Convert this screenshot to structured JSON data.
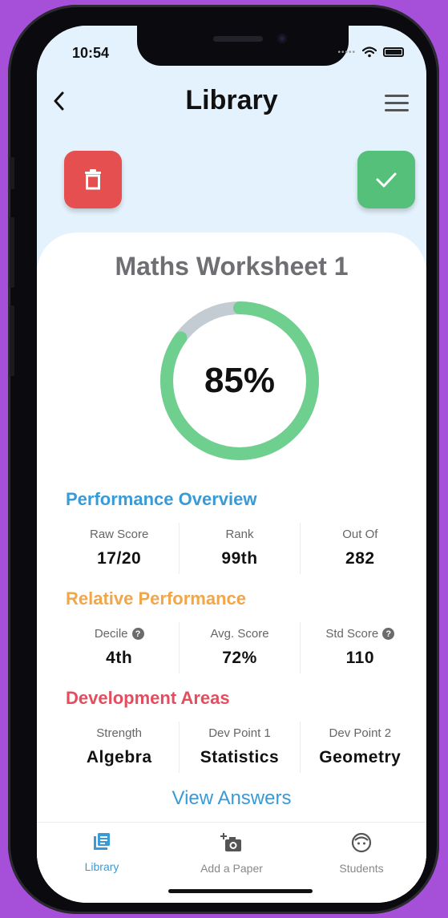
{
  "status_bar": {
    "time": "10:54"
  },
  "header": {
    "title": "Library"
  },
  "worksheet": {
    "title": "Maths Worksheet 1",
    "score_percent": 85,
    "score_label": "85%"
  },
  "sections": {
    "performance": {
      "title": "Performance Overview",
      "stats": [
        {
          "label": "Raw Score",
          "value": "17/20"
        },
        {
          "label": "Rank",
          "value": "99th"
        },
        {
          "label": "Out Of",
          "value": "282"
        }
      ]
    },
    "relative": {
      "title": "Relative Performance",
      "stats": [
        {
          "label": "Decile",
          "value": "4th"
        },
        {
          "label": "Avg. Score",
          "value": "72%"
        },
        {
          "label": "Std Score",
          "value": "110"
        }
      ]
    },
    "development": {
      "title": "Development Areas",
      "stats": [
        {
          "label": "Strength",
          "value": "Algebra"
        },
        {
          "label": "Dev Point 1",
          "value": "Statistics"
        },
        {
          "label": "Dev Point 2",
          "value": "Geometry"
        }
      ]
    }
  },
  "view_answers_label": "View Answers",
  "tabs": [
    {
      "label": "Library",
      "icon": "library-icon",
      "active": true
    },
    {
      "label": "Add a Paper",
      "icon": "add-camera-icon",
      "active": false
    },
    {
      "label": "Students",
      "icon": "student-face-icon",
      "active": false
    }
  ],
  "colors": {
    "accent_blue": "#3a9ad6",
    "accent_orange": "#f2a64a",
    "accent_red": "#e34d5e",
    "ring_green": "#6fcf8e",
    "ring_track": "#c3ccd2",
    "delete_red": "#e64f4f",
    "confirm_green": "#55c07a"
  }
}
